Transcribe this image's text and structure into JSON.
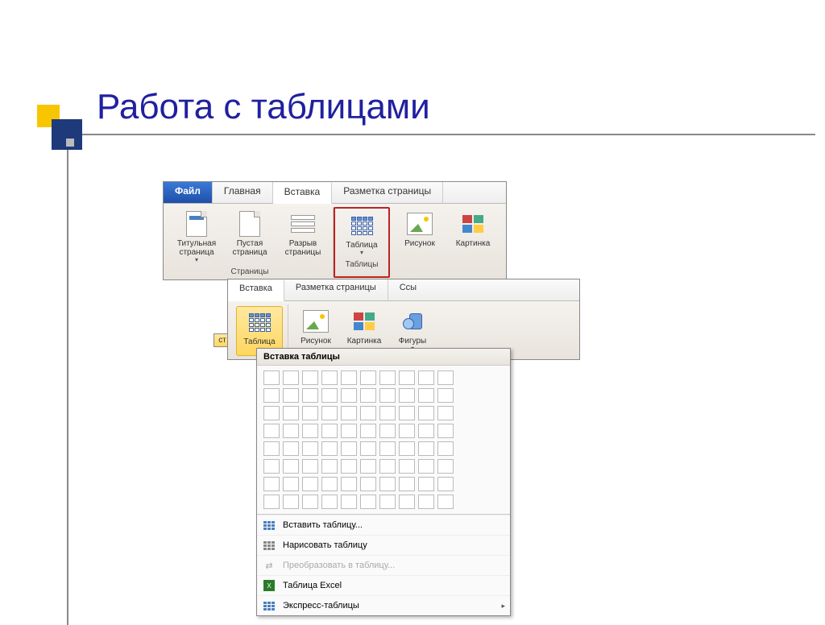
{
  "slide": {
    "title": "Работа с таблицами"
  },
  "ribbon1": {
    "tabs": {
      "file": "Файл",
      "home": "Главная",
      "insert": "Вставка",
      "layout": "Разметка страницы"
    },
    "items": {
      "title_page": "Титульная страница",
      "blank_page": "Пустая страница",
      "page_break": "Разрыв страницы",
      "table": "Таблица",
      "picture": "Рисунок",
      "clipart": "Картинка"
    },
    "groups": {
      "pages": "Страницы",
      "tables": "Таблицы"
    }
  },
  "ribbon2": {
    "tabs": {
      "insert": "Вставка",
      "layout": "Разметка страницы",
      "refs": "Ссы"
    },
    "items": {
      "table": "Таблица",
      "picture": "Рисунок",
      "clipart": "Картинка",
      "shapes": "Фигуры"
    },
    "sidebar": "ст"
  },
  "dropdown": {
    "header": "Вставка таблицы",
    "grid": {
      "cols": 10,
      "rows": 8
    },
    "menu": {
      "insert": "Вставить таблицу...",
      "draw": "Нарисовать таблицу",
      "convert": "Преобразовать в таблицу...",
      "excel": "Таблица Excel",
      "quick": "Экспресс-таблицы"
    }
  }
}
